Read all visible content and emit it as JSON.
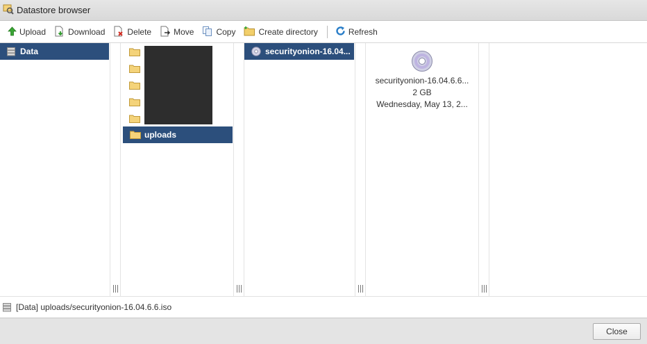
{
  "window": {
    "title": "Datastore browser"
  },
  "toolbar": {
    "upload": "Upload",
    "download": "Download",
    "delete": "Delete",
    "move": "Move",
    "copy": "Copy",
    "create_directory": "Create directory",
    "refresh": "Refresh"
  },
  "datastores": [
    {
      "label": "Data",
      "selected": true
    }
  ],
  "folders": {
    "redacted_count": 5,
    "visible": [
      {
        "label": "uploads",
        "selected": true
      }
    ]
  },
  "files": [
    {
      "label": "securityonion-16.04...",
      "selected": true,
      "icon": "disc-icon"
    }
  ],
  "preview": {
    "name": "securityonion-16.04.6.6...",
    "size": "2 GB",
    "date": "Wednesday, May 13, 2..."
  },
  "status": {
    "path": "[Data] uploads/securityonion-16.04.6.6.iso"
  },
  "footer": {
    "close_label": "Close"
  },
  "colors": {
    "selection": "#2c4f7c",
    "redaction": "#2d2d2d"
  }
}
